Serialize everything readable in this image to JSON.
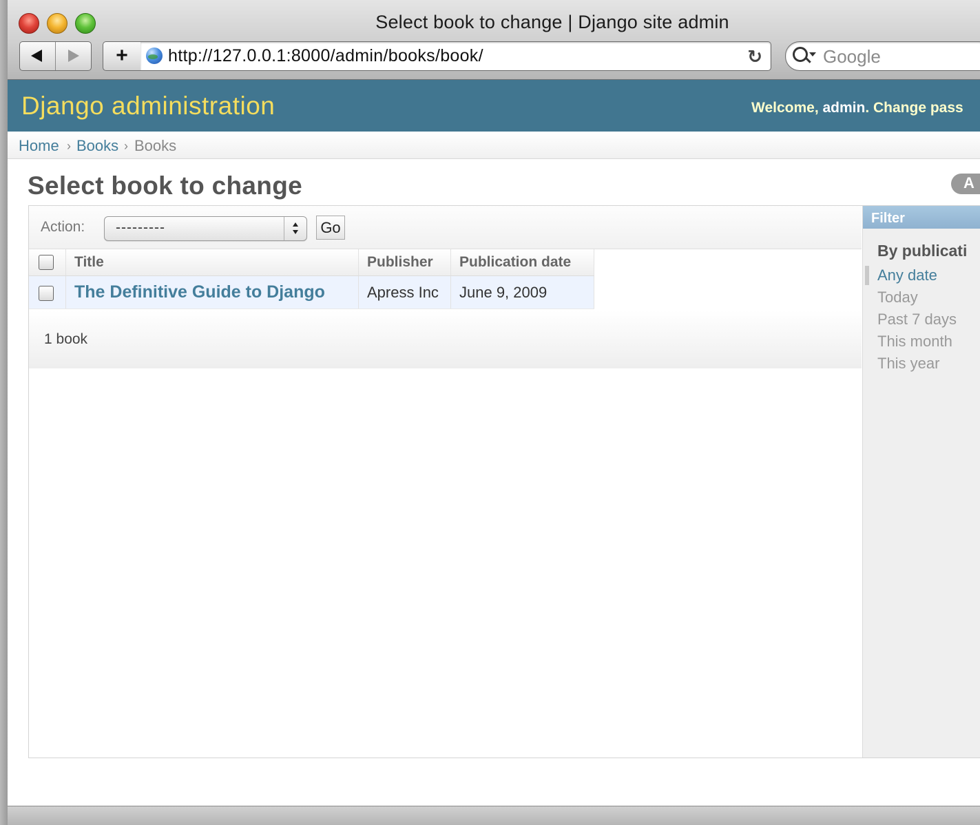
{
  "browser": {
    "window_title": "Select book to change | Django site admin",
    "url": "http://127.0.0.1:8000/admin/books/book/",
    "search_placeholder": "Google"
  },
  "header": {
    "brand": "Django administration",
    "welcome_prefix": "Welcome, ",
    "username": "admin",
    "welcome_suffix": ". Change pass"
  },
  "breadcrumbs": {
    "home": "Home",
    "app": "Books",
    "current": "Books",
    "separator": "›"
  },
  "page": {
    "title": "Select book to change",
    "add_button_label": "A"
  },
  "actions": {
    "label": "Action:",
    "selected": "---------",
    "go_label": "Go"
  },
  "table": {
    "columns": [
      "Title",
      "Publisher",
      "Publication date"
    ],
    "rows": [
      {
        "title": "The Definitive Guide to Django",
        "publisher": "Apress Inc",
        "publication_date": "June 9, 2009"
      }
    ]
  },
  "paginator": {
    "count_text": "1 book"
  },
  "filter": {
    "heading": "Filter",
    "subheading": "By publicati",
    "options": [
      "Any date",
      "Today",
      "Past 7 days",
      "This month",
      "This year"
    ],
    "selected_index": 0
  },
  "colors": {
    "header_bg": "#417690",
    "brand_text": "#f5dd5d",
    "link": "#447e9b",
    "row_bg": "#edf3fe"
  }
}
